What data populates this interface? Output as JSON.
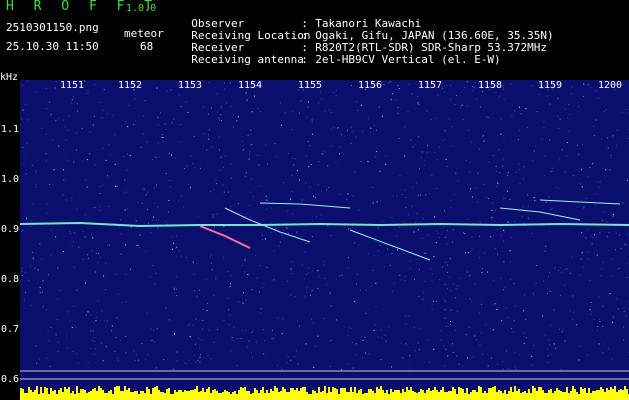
{
  "header": {
    "app_name": "H R O F F T",
    "version": "1.0.0",
    "file_name": "2510301150.png",
    "mode": "meteor",
    "date_time": "25.10.30 11:50",
    "count": "68"
  },
  "meta": [
    {
      "key": "Observer",
      "value": "Takanori Kawachi"
    },
    {
      "key": "Receiving Location",
      "value": "Ogaki, Gifu, JAPAN (136.60E, 35.35N)"
    },
    {
      "key": "Receiver",
      "value": "R820T2(RTL-SDR) SDR-Sharp 53.372MHz"
    },
    {
      "key": "Receiving antenna",
      "value": "2el-HB9CV Vertical (el. E-W)"
    }
  ],
  "axis": {
    "unit": "kHz",
    "y_ticks": [
      "1.1",
      "1.0",
      "0.9",
      "0.8",
      "0.7",
      "0.6"
    ],
    "x_ticks": [
      "1151",
      "1152",
      "1153",
      "1154",
      "1155",
      "1156",
      "1157",
      "1158",
      "1159",
      "1200"
    ]
  },
  "colors": {
    "background": "#0a0f6e",
    "trace": "#7fffd4",
    "baseline": "#ffff00"
  }
}
